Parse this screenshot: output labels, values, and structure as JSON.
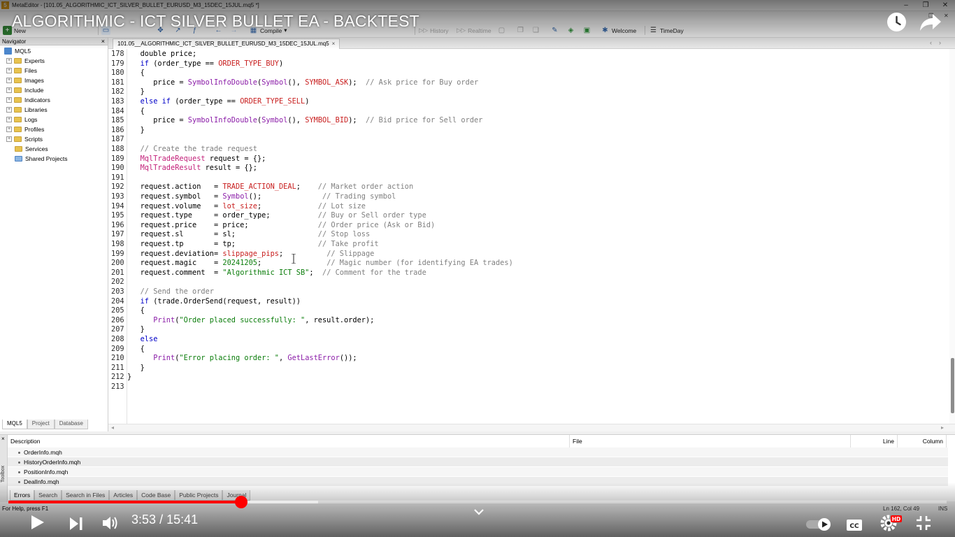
{
  "window": {
    "app_icon": "5",
    "title": "MetaEditor - [101.05_ALGORITHMIC_ICT_SILVER_BULLET_EURUSD_M3_15DEC_15JUL.mq5 *]",
    "minimize": "–",
    "maximize": "❐",
    "close": "✕"
  },
  "menubar": {
    "restore": "❐",
    "close": "✕"
  },
  "toolbar": {
    "new_label": "New",
    "compile_label": "Compile",
    "history_label": "History",
    "realtime_label": "Realtime",
    "welcome_label": "Welcome",
    "timeday_label": "TimeDay"
  },
  "navigator": {
    "title": "Navigator",
    "close": "×",
    "root": "MQL5",
    "items": [
      "Experts",
      "Files",
      "Images",
      "Include",
      "Indicators",
      "Libraries",
      "Logs",
      "Profiles",
      "Scripts",
      "Services",
      "Shared Projects"
    ],
    "tabs": [
      "MQL5",
      "Project",
      "Database"
    ]
  },
  "document": {
    "tab_label": "101.05__ALGORITHMIC_ICT_SILVER_BULLET_EURUSD_M3_15DEC_15JUL.mq5",
    "tab_close": "×",
    "nav_arrows": "‹›"
  },
  "code": {
    "lines": [
      {
        "n": "178",
        "t": [
          [
            "",
            "   double price;"
          ]
        ]
      },
      {
        "n": "179",
        "t": [
          [
            "kw",
            "   if"
          ],
          [
            "",
            " (order_type == "
          ],
          [
            "cst",
            "ORDER_TYPE_BUY"
          ],
          [
            "",
            ")"
          ]
        ]
      },
      {
        "n": "180",
        "t": [
          [
            "",
            "   {"
          ]
        ]
      },
      {
        "n": "181",
        "t": [
          [
            "",
            "      price = "
          ],
          [
            "fn",
            "SymbolInfoDouble"
          ],
          [
            "",
            "("
          ],
          [
            "fn",
            "Symbol"
          ],
          [
            "",
            "(), "
          ],
          [
            "cst",
            "SYMBOL_ASK"
          ],
          [
            "",
            ");  "
          ],
          [
            "cmt",
            "// Ask price for Buy order"
          ]
        ]
      },
      {
        "n": "182",
        "t": [
          [
            "",
            "   }"
          ]
        ]
      },
      {
        "n": "183",
        "t": [
          [
            "kw",
            "   else if"
          ],
          [
            "",
            " (order_type == "
          ],
          [
            "cst",
            "ORDER_TYPE_SELL"
          ],
          [
            "",
            ")"
          ]
        ]
      },
      {
        "n": "184",
        "t": [
          [
            "",
            "   {"
          ]
        ]
      },
      {
        "n": "185",
        "t": [
          [
            "",
            "      price = "
          ],
          [
            "fn",
            "SymbolInfoDouble"
          ],
          [
            "",
            "("
          ],
          [
            "fn",
            "Symbol"
          ],
          [
            "",
            "(), "
          ],
          [
            "cst",
            "SYMBOL_BID"
          ],
          [
            "",
            ");  "
          ],
          [
            "cmt",
            "// Bid price for Sell order"
          ]
        ]
      },
      {
        "n": "186",
        "t": [
          [
            "",
            "   }"
          ]
        ]
      },
      {
        "n": "187",
        "t": [
          [
            "",
            ""
          ]
        ]
      },
      {
        "n": "188",
        "t": [
          [
            "cmt",
            "   // Create the trade request"
          ]
        ]
      },
      {
        "n": "189",
        "t": [
          [
            "typ",
            "   MqlTradeRequest"
          ],
          [
            "",
            " request = {};"
          ]
        ]
      },
      {
        "n": "190",
        "t": [
          [
            "typ",
            "   MqlTradeResult"
          ],
          [
            "",
            " result = {};"
          ]
        ]
      },
      {
        "n": "191",
        "t": [
          [
            "",
            ""
          ]
        ]
      },
      {
        "n": "192",
        "t": [
          [
            "",
            "   request.action   = "
          ],
          [
            "cst",
            "TRADE_ACTION_DEAL"
          ],
          [
            "",
            ";    "
          ],
          [
            "cmt",
            "// Market order action"
          ]
        ]
      },
      {
        "n": "193",
        "t": [
          [
            "",
            "   request.symbol   = "
          ],
          [
            "fn",
            "Symbol"
          ],
          [
            "",
            "();              "
          ],
          [
            "cmt",
            "// Trading symbol"
          ]
        ]
      },
      {
        "n": "194",
        "t": [
          [
            "",
            "   request.volume   = "
          ],
          [
            "cst",
            "lot_size"
          ],
          [
            "",
            ";             "
          ],
          [
            "cmt",
            "// Lot size"
          ]
        ]
      },
      {
        "n": "195",
        "t": [
          [
            "",
            "   request.type     = order_type;           "
          ],
          [
            "cmt",
            "// Buy or Sell order type"
          ]
        ]
      },
      {
        "n": "196",
        "t": [
          [
            "",
            "   request.price    = price;                "
          ],
          [
            "cmt",
            "// Order price (Ask or Bid)"
          ]
        ]
      },
      {
        "n": "197",
        "t": [
          [
            "",
            "   request.sl       = sl;                   "
          ],
          [
            "cmt",
            "// Stop loss"
          ]
        ]
      },
      {
        "n": "198",
        "t": [
          [
            "",
            "   request.tp       = tp;                   "
          ],
          [
            "cmt",
            "// Take profit"
          ]
        ]
      },
      {
        "n": "199",
        "t": [
          [
            "",
            "   request.deviation= "
          ],
          [
            "cst",
            "slippage_pips"
          ],
          [
            "",
            ";          "
          ],
          [
            "cmt",
            "// Slippage"
          ]
        ]
      },
      {
        "n": "200",
        "t": [
          [
            "",
            "   request.magic    = "
          ],
          [
            "num",
            "20241205"
          ],
          [
            "",
            ";               "
          ],
          [
            "cmt",
            "// Magic number (for identifying EA trades)"
          ]
        ]
      },
      {
        "n": "201",
        "t": [
          [
            "",
            "   request.comment  = "
          ],
          [
            "str",
            "\"Algorithmic ICT SB\""
          ],
          [
            "",
            ";  "
          ],
          [
            "cmt",
            "// Comment for the trade"
          ]
        ]
      },
      {
        "n": "202",
        "t": [
          [
            "",
            ""
          ]
        ]
      },
      {
        "n": "203",
        "t": [
          [
            "cmt",
            "   // Send the order"
          ]
        ]
      },
      {
        "n": "204",
        "t": [
          [
            "kw",
            "   if"
          ],
          [
            "",
            " (trade.OrderSend(request, result))"
          ]
        ]
      },
      {
        "n": "205",
        "t": [
          [
            "",
            "   {"
          ]
        ]
      },
      {
        "n": "206",
        "t": [
          [
            "fn",
            "      Print"
          ],
          [
            "",
            "("
          ],
          [
            "str",
            "\"Order placed successfully: \""
          ],
          [
            "",
            ", result.order);"
          ]
        ]
      },
      {
        "n": "207",
        "t": [
          [
            "",
            "   }"
          ]
        ]
      },
      {
        "n": "208",
        "t": [
          [
            "kw",
            "   else"
          ]
        ]
      },
      {
        "n": "209",
        "t": [
          [
            "",
            "   {"
          ]
        ]
      },
      {
        "n": "210",
        "t": [
          [
            "fn",
            "      Print"
          ],
          [
            "",
            "("
          ],
          [
            "str",
            "\"Error placing order: \""
          ],
          [
            "",
            ", "
          ],
          [
            "fn",
            "GetLastError"
          ],
          [
            "",
            "());"
          ]
        ]
      },
      {
        "n": "211",
        "t": [
          [
            "",
            "   }"
          ]
        ]
      },
      {
        "n": "212",
        "t": [
          [
            "",
            "}"
          ]
        ]
      },
      {
        "n": "213",
        "t": [
          [
            "",
            ""
          ]
        ]
      }
    ]
  },
  "hscroll": {
    "left": "◂",
    "right": "▸"
  },
  "toolbox": {
    "side_label": "Toolbox",
    "close": "×",
    "columns": [
      "Description",
      "File",
      "Line",
      "Column"
    ],
    "rows": [
      "OrderInfo.mqh",
      "HistoryOrderInfo.mqh",
      "PositionInfo.mqh",
      "DealInfo.mqh"
    ],
    "tabs": [
      "Errors",
      "Search",
      "Search in Files",
      "Articles",
      "Code Base",
      "Public Projects",
      "Journal"
    ]
  },
  "statusbar": {
    "help": "For Help, press F1",
    "position": "Ln 162, Col 49",
    "mode": "INS"
  },
  "video": {
    "title": "ALGORITHMIC - ICT SILVER BULLET EA - BACKTEST",
    "current_time": "3:53",
    "duration": "15:41",
    "played_fraction": 0.248,
    "buffered_fraction": 0.33,
    "quality_badge": "HD",
    "accent_color": "#ff0000"
  }
}
